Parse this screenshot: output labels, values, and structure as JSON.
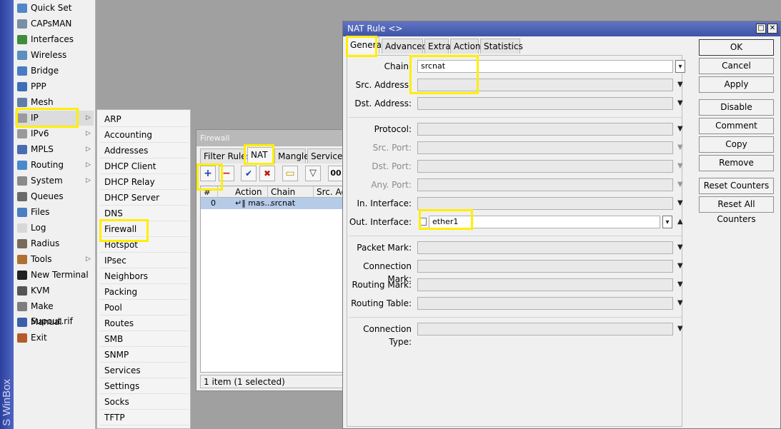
{
  "app": {
    "brand": "S WinBox"
  },
  "main_menu": {
    "items": [
      {
        "label": "Quick Set",
        "icon": "quick-set-icon",
        "color": "#4f86c9",
        "arrow": false
      },
      {
        "label": "CAPsMAN",
        "icon": "capsman-icon",
        "color": "#7a8fa3",
        "arrow": false
      },
      {
        "label": "Interfaces",
        "icon": "interfaces-icon",
        "color": "#3e8c3e",
        "arrow": false
      },
      {
        "label": "Wireless",
        "icon": "wireless-icon",
        "color": "#5a8fbf",
        "arrow": false
      },
      {
        "label": "Bridge",
        "icon": "bridge-icon",
        "color": "#4a7cc2",
        "arrow": false
      },
      {
        "label": "PPP",
        "icon": "ppp-icon",
        "color": "#3d6fb5",
        "arrow": false
      },
      {
        "label": "Mesh",
        "icon": "mesh-icon",
        "color": "#5e7fa8",
        "arrow": false
      },
      {
        "label": "IP",
        "icon": "ip-icon",
        "color": "#9a9a9a",
        "arrow": true
      },
      {
        "label": "IPv6",
        "icon": "ipv6-icon",
        "color": "#9a9a9a",
        "arrow": true
      },
      {
        "label": "MPLS",
        "icon": "mpls-icon",
        "color": "#4a6cb0",
        "arrow": true
      },
      {
        "label": "Routing",
        "icon": "routing-icon",
        "color": "#4a8acb",
        "arrow": true
      },
      {
        "label": "System",
        "icon": "system-icon",
        "color": "#8a8a8a",
        "arrow": true
      },
      {
        "label": "Queues",
        "icon": "queues-icon",
        "color": "#6a6a6a",
        "arrow": false
      },
      {
        "label": "Files",
        "icon": "files-icon",
        "color": "#4b7fc1",
        "arrow": false
      },
      {
        "label": "Log",
        "icon": "log-icon",
        "color": "#d8d8d8",
        "arrow": false
      },
      {
        "label": "Radius",
        "icon": "radius-icon",
        "color": "#7a6a5a",
        "arrow": false
      },
      {
        "label": "Tools",
        "icon": "tools-icon",
        "color": "#b07030",
        "arrow": true
      },
      {
        "label": "New Terminal",
        "icon": "terminal-icon",
        "color": "#222222",
        "arrow": false
      },
      {
        "label": "KVM",
        "icon": "kvm-icon",
        "color": "#555555",
        "arrow": false
      },
      {
        "label": "Make Supout.rif",
        "icon": "supout-icon",
        "color": "#7d7d7d",
        "arrow": false
      },
      {
        "label": "Manual",
        "icon": "manual-icon",
        "color": "#3b5fa8",
        "arrow": false
      },
      {
        "label": "Exit",
        "icon": "exit-icon",
        "color": "#b55a2a",
        "arrow": false
      }
    ]
  },
  "ip_submenu": {
    "items": [
      "ARP",
      "Accounting",
      "Addresses",
      "DHCP Client",
      "DHCP Relay",
      "DHCP Server",
      "DNS",
      "Firewall",
      "Hotspot",
      "IPsec",
      "Neighbors",
      "Packing",
      "Pool",
      "Routes",
      "SMB",
      "SNMP",
      "Services",
      "Settings",
      "Socks",
      "TFTP"
    ]
  },
  "firewall": {
    "title": "Firewall",
    "tabs": [
      "Filter Rules",
      "NAT",
      "Mangle",
      "Service Po"
    ],
    "active_tab": "NAT",
    "columns": [
      "#",
      "Action",
      "Chain",
      "Src. Ad"
    ],
    "rows": [
      {
        "num": "0",
        "action": "↵‖ mas...",
        "chain": "srcnat"
      }
    ],
    "status": "1 item (1 selected)",
    "toolbar": {
      "add": "+",
      "remove": "−",
      "enable": "✔",
      "disable": "✖",
      "comment": "▭",
      "filter": "▽",
      "more": "00"
    }
  },
  "nat_rule": {
    "title": "NAT Rule <>",
    "tabs": [
      "General",
      "Advanced",
      "Extra",
      "Action",
      "Statistics"
    ],
    "active_tab": "General",
    "fields": {
      "chain": {
        "label": "Chain:",
        "value": "srcnat"
      },
      "src_address": {
        "label": "Src. Address:",
        "value": ""
      },
      "dst_address": {
        "label": "Dst. Address:",
        "value": ""
      },
      "protocol": {
        "label": "Protocol:",
        "value": ""
      },
      "src_port": {
        "label": "Src. Port:",
        "value": ""
      },
      "dst_port": {
        "label": "Dst. Port:",
        "value": ""
      },
      "any_port": {
        "label": "Any. Port:",
        "value": ""
      },
      "in_interface": {
        "label": "In. Interface:",
        "value": ""
      },
      "out_interface": {
        "label": "Out. Interface:",
        "value": "ether1"
      },
      "packet_mark": {
        "label": "Packet Mark:",
        "value": ""
      },
      "connection_mark": {
        "label": "Connection Mark:",
        "value": ""
      },
      "routing_mark": {
        "label": "Routing Mark:",
        "value": ""
      },
      "routing_table": {
        "label": "Routing Table:",
        "value": ""
      },
      "connection_type": {
        "label": "Connection Type:",
        "value": ""
      }
    },
    "buttons": {
      "ok": "OK",
      "cancel": "Cancel",
      "apply": "Apply",
      "disable": "Disable",
      "comment": "Comment",
      "copy": "Copy",
      "remove": "Remove",
      "reset_counters": "Reset Counters",
      "reset_all_counters": "Reset All Counters"
    },
    "win_controls": {
      "maximize": "□",
      "close": "✕"
    }
  },
  "highlight_color": "#ffee00"
}
